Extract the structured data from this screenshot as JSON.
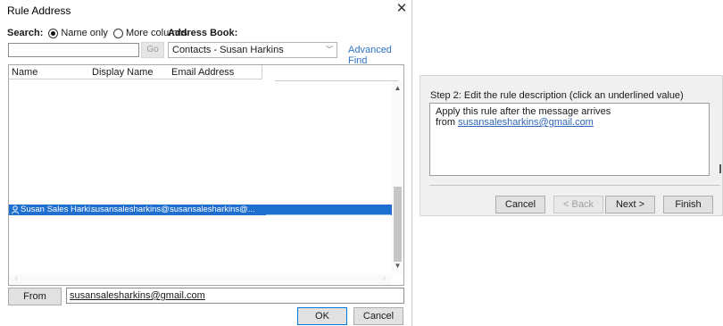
{
  "dialog": {
    "title": "Rule Address",
    "search_label": "Search:",
    "radio_name_only": "Name only",
    "radio_more_columns": "More columns",
    "address_book_label": "Address Book:",
    "search_value": "",
    "go_label": "Go",
    "address_book_selected": "Contacts - Susan Harkins",
    "advanced_find": "Advanced Find",
    "columns": [
      "Name",
      "Display Name",
      "Email Address"
    ],
    "rows": [
      {
        "name": "Susan Sales Harki...",
        "display_name": "susansalesharkins@...",
        "email": "susansalesharkins@..."
      }
    ],
    "from_label": "From",
    "from_value": "susansalesharkins@gmail.com",
    "ok_label": "OK",
    "cancel_label": "Cancel"
  },
  "wizard": {
    "step2_label": "Step 2: Edit the rule description (click an underlined value)",
    "line1": "Apply this rule after the message arrives",
    "line2_prefix": "from ",
    "line2_link": "susansalesharkins@gmail.com",
    "buttons": {
      "cancel": "Cancel",
      "back": "< Back",
      "next": "Next >",
      "finish": "Finish"
    }
  },
  "colors": {
    "selection": "#1e6fd0",
    "link": "#2e73c9",
    "default_button_border": "#0078d7"
  },
  "icons": [
    "close-icon",
    "chevron-down-icon",
    "person-icon",
    "scroll-up-icon",
    "scroll-down-icon",
    "scroll-left-icon",
    "scroll-right-icon"
  ]
}
